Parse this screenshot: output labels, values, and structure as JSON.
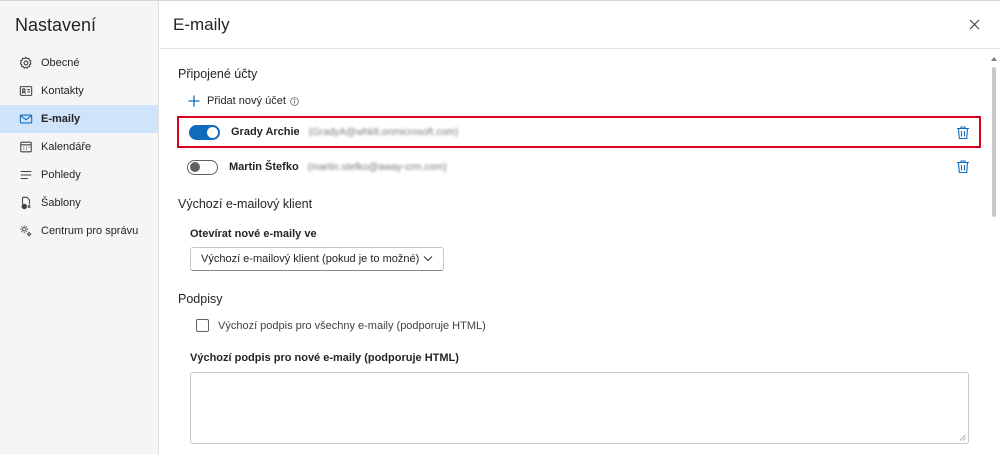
{
  "sidebar": {
    "title": "Nastavení",
    "items": [
      {
        "label": "Obecné",
        "icon": "gear-icon"
      },
      {
        "label": "Kontakty",
        "icon": "contact-card-icon"
      },
      {
        "label": "E-maily",
        "icon": "mail-icon",
        "active": true
      },
      {
        "label": "Kalendáře",
        "icon": "calendar-icon"
      },
      {
        "label": "Pohledy",
        "icon": "list-icon"
      },
      {
        "label": "Šablony",
        "icon": "template-icon"
      },
      {
        "label": "Centrum pro správu",
        "icon": "admin-gear-icon"
      }
    ]
  },
  "header": {
    "title": "E-maily",
    "close_icon": "close-icon"
  },
  "connected": {
    "title": "Připojené účty",
    "add_label": "Přidat nový účet",
    "accounts": [
      {
        "name": "Grady Archie",
        "email": "(GradyA@whklt.onmicrosoft.com)",
        "enabled": true,
        "highlighted": true
      },
      {
        "name": "Martin Štefko",
        "email": "(martin.stefko@away-crm.com)",
        "enabled": false,
        "highlighted": false
      }
    ]
  },
  "default_client": {
    "title": "Výchozí e-mailový klient",
    "open_label": "Otevírat nové e-maily ve",
    "selected": "Výchozí e-mailový klient (pokud je to možné)"
  },
  "signatures": {
    "title": "Podpisy",
    "checkbox_label": "Výchozí podpis pro všechny e-maily (podporuje HTML)",
    "checkbox_checked": false,
    "new_sig_label": "Výchozí podpis pro nové e-maily (podporuje HTML)",
    "new_sig_value": ""
  },
  "colors": {
    "accent": "#0f6cbd",
    "highlight_border": "#d6001c",
    "active_nav_bg": "#cfe4fa",
    "sidebar_bg": "#f5f5f5"
  }
}
